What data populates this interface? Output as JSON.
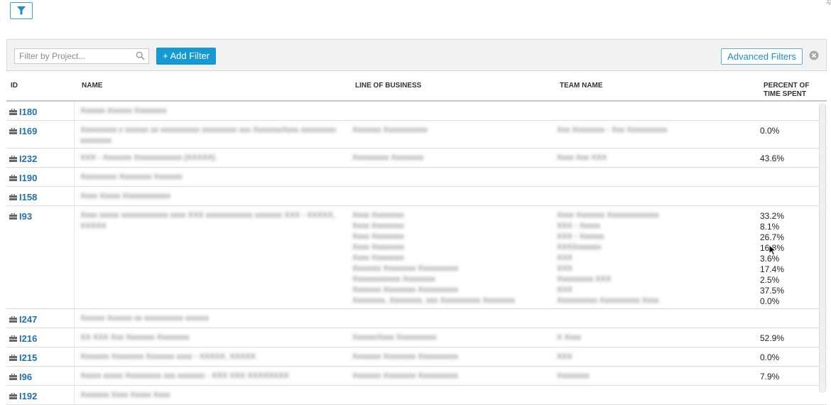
{
  "toolbar": {
    "filter_icon": "funnel-icon"
  },
  "filter_bar": {
    "search_placeholder": "Filter by Project...",
    "add_filter_label": "+ Add Filter",
    "advanced_filters_label": "Advanced Filters"
  },
  "columns": {
    "id": "ID",
    "name": "NAME",
    "line_of_business": "LINE OF BUSINESS",
    "team_name": "TEAM NAME",
    "percent_line1": "PERCENT OF",
    "percent_line2": "TIME SPENT"
  },
  "rows": [
    {
      "id": "I180",
      "pct": []
    },
    {
      "id": "I169",
      "pct": [
        "0.0%"
      ]
    },
    {
      "id": "I232",
      "pct": [
        "43.6%"
      ]
    },
    {
      "id": "I190",
      "pct": []
    },
    {
      "id": "I158",
      "pct": []
    },
    {
      "id": "I93",
      "pct": [
        "33.2%",
        "8.1%",
        "26.7%",
        "16.8%",
        "3.6%",
        "17.4%",
        "2.5%",
        "37.5%",
        "0.0%"
      ]
    },
    {
      "id": "I247",
      "pct": []
    },
    {
      "id": "I216",
      "pct": [
        "52.9%"
      ]
    },
    {
      "id": "I215",
      "pct": [
        "0.0%"
      ]
    },
    {
      "id": "I96",
      "pct": [
        "7.9%"
      ]
    },
    {
      "id": "I192",
      "pct": []
    }
  ]
}
